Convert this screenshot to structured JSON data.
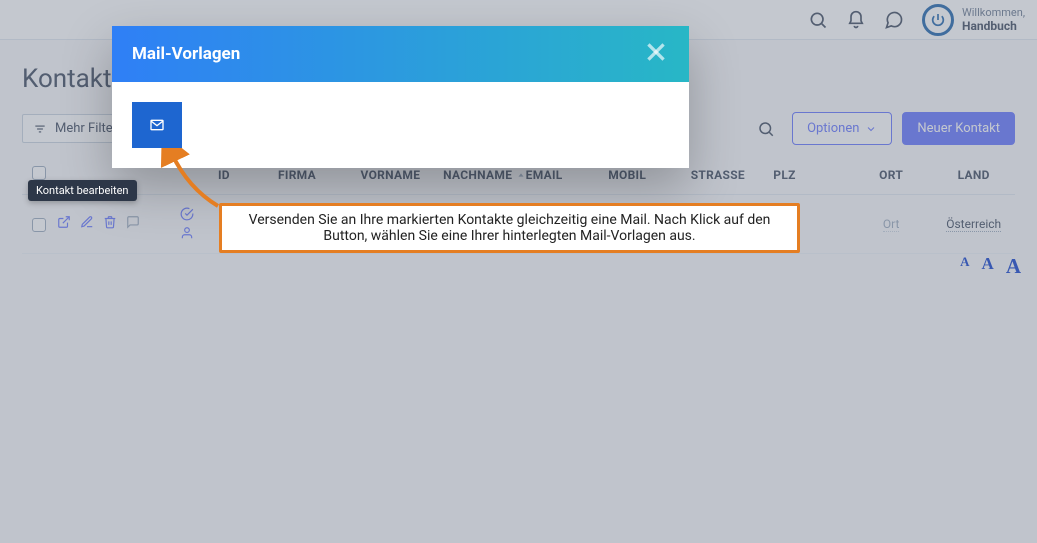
{
  "topbar": {
    "welcome": "Willkommen,",
    "username": "Handbuch"
  },
  "page": {
    "title": "Kontakte"
  },
  "toolbar": {
    "filter_label": "Mehr Filter",
    "options_label": "Optionen",
    "new_label": "Neuer Kontakt"
  },
  "tooltip": {
    "edit_contact": "Kontakt bearbeiten"
  },
  "table": {
    "headers": {
      "id": "ID",
      "firma": "FIRMA",
      "vorname": "VORNAME",
      "nachname": "NACHNAME",
      "email": "EMAIL",
      "mobil": "MOBIL",
      "strasse": "STRASSE",
      "plz": "PLZ",
      "ort": "ORT",
      "land": "LAND"
    },
    "rows": [
      {
        "ort": "Ort",
        "land": "Österreich"
      }
    ]
  },
  "modal": {
    "title": "Mail-Vorlagen"
  },
  "callout": {
    "text": "Versenden Sie an Ihre markierten Kontakte gleichzeitig eine Mail. Nach Klick auf den Button, wählen Sie eine Ihrer hinterlegten Mail-Vorlagen aus."
  },
  "font_sizes": {
    "s": "A",
    "m": "A",
    "l": "A"
  }
}
